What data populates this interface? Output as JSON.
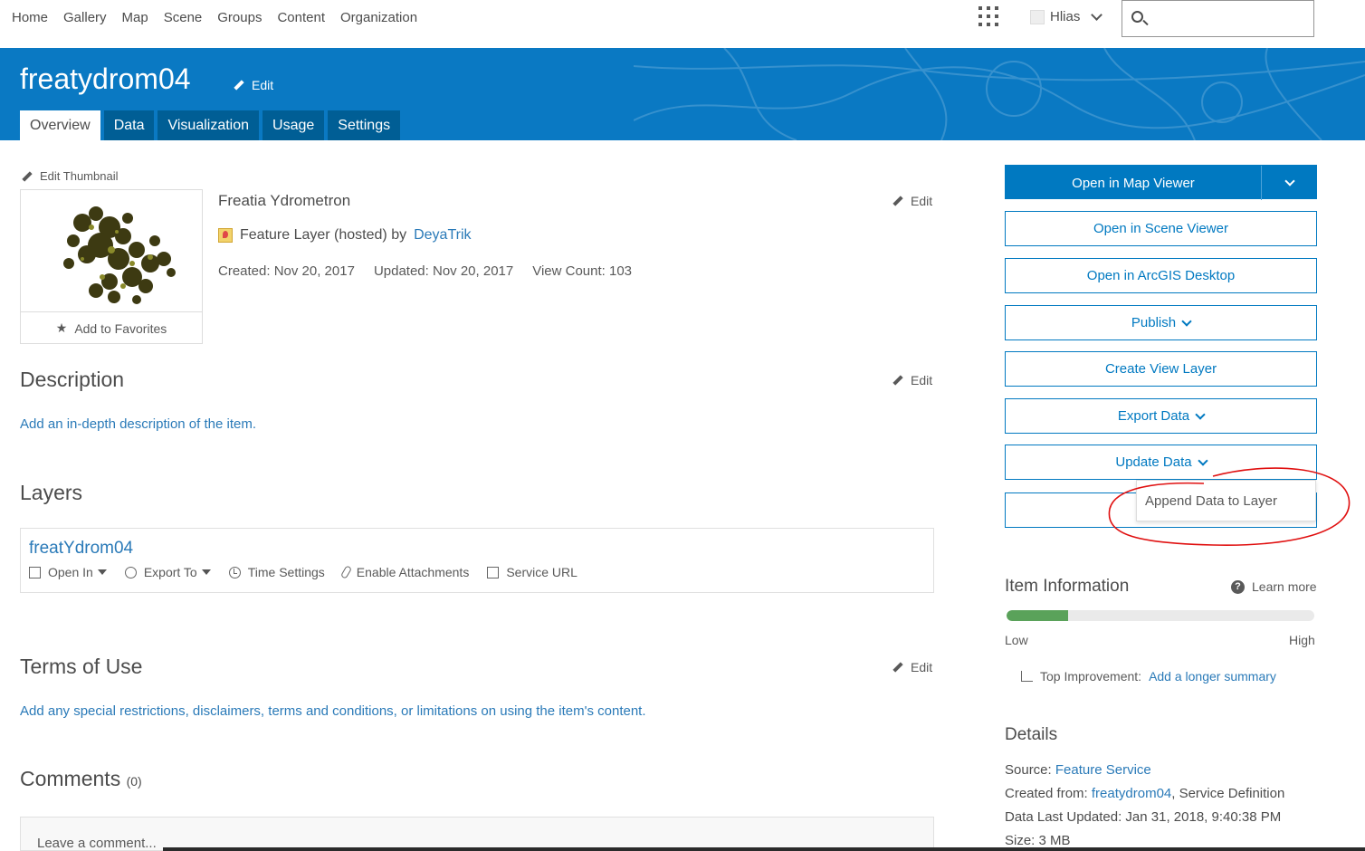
{
  "nav": {
    "links": [
      "Home",
      "Gallery",
      "Map",
      "Scene",
      "Groups",
      "Content",
      "Organization"
    ],
    "user": "Hlias",
    "search_placeholder": ""
  },
  "header": {
    "title": "freatydrom04",
    "edit_label": "Edit",
    "tabs": [
      "Overview",
      "Data",
      "Visualization",
      "Usage",
      "Settings"
    ],
    "active_tab": "Overview",
    "color": "#0a79c3"
  },
  "item": {
    "edit_thumbnail": "Edit Thumbnail",
    "add_favorites": "Add to Favorites",
    "name": "Freatia Ydrometron",
    "edit": "Edit",
    "type_text": "Feature Layer (hosted) by",
    "owner": "DeyaTrik",
    "created": "Created: Nov 20, 2017",
    "updated": "Updated: Nov 20, 2017",
    "view_count": "View Count: 103"
  },
  "description": {
    "title": "Description",
    "edit": "Edit",
    "text": "Add an in-depth description of the item."
  },
  "layers": {
    "title": "Layers",
    "layer_name": "freatYdrom04",
    "actions": {
      "open_in": "Open In",
      "export_to": "Export To",
      "time_settings": "Time Settings",
      "enable_attachments": "Enable Attachments",
      "service_url": "Service URL"
    }
  },
  "terms": {
    "title": "Terms of Use",
    "edit": "Edit",
    "text": "Add any special restrictions, disclaimers, terms and conditions, or limitations on using the item's content."
  },
  "comments": {
    "title": "Comments",
    "count": "(0)",
    "placeholder": "Leave a comment..."
  },
  "actions": {
    "open_map_viewer": "Open in Map Viewer",
    "open_scene_viewer": "Open in Scene Viewer",
    "open_arcgis_desktop": "Open in ArcGIS Desktop",
    "publish": "Publish",
    "create_view_layer": "Create View Layer",
    "export_data": "Export Data",
    "update_data": "Update Data",
    "update_menu_item": "Append Data to Layer",
    "accent": "#0079c1"
  },
  "item_info": {
    "title": "Item Information",
    "learn_more": "Learn more",
    "score_fraction": 0.2,
    "low": "Low",
    "high": "High",
    "top_improvement_label": "Top Improvement:",
    "top_improvement_link": "Add a longer summary"
  },
  "details": {
    "title": "Details",
    "source_label": "Source:",
    "source_value": "Feature Service",
    "created_from_label": "Created from:",
    "created_from_link": "freatydrom04",
    "created_from_rest": ", Service Definition",
    "data_last_updated": "Data Last Updated: Jan 31, 2018, 9:40:38 PM",
    "size": "Size: 3 MB"
  }
}
